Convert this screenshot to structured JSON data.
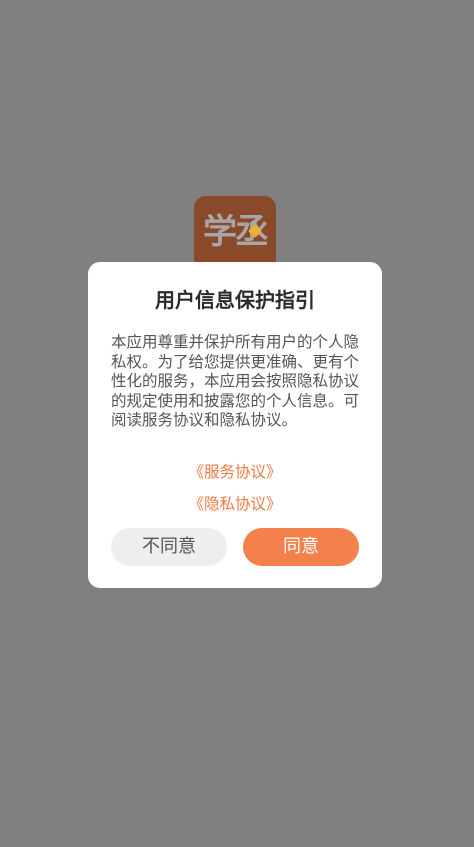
{
  "app": {
    "logo_text": "学丞",
    "logo_bg_color": "#8a4a2a",
    "overlay_color": "#808080"
  },
  "dialog": {
    "title": "用户信息保护指引",
    "body": "本应用尊重并保护所有用户的个人隐私权。为了给您提供更准确、更有个性化的服务，本应用会按照隐私协议的规定使用和披露您的个人信息。可阅读服务协议和隐私协议。",
    "service_link": "《服务协议》",
    "privacy_link": "《隐私协议》",
    "disagree_label": "不同意",
    "agree_label": "同意",
    "accent_color": "#f4814b"
  }
}
